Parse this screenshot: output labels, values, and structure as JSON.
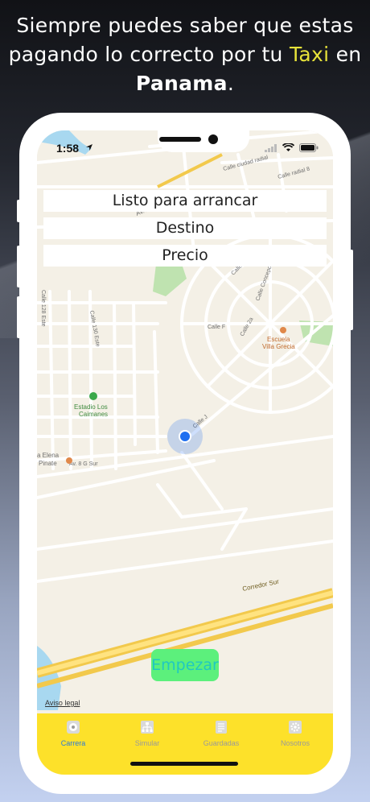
{
  "headline": {
    "part1": "Siempre puedes saber que estas pagando lo correcto por tu ",
    "taxi_word": "Taxi",
    "part2": " en ",
    "place": "Panama",
    "period": "."
  },
  "colors": {
    "taxi_accent": "#e6e23a",
    "tabbar_bg": "#fde12a",
    "tab_active": "#2a7ad8",
    "button_bg": "#5cf07c",
    "button_text": "#20c8c0",
    "location_dot": "#1e6ff0"
  },
  "status_bar": {
    "time": "1:58"
  },
  "map": {
    "labels": {
      "agustin": "Av. Agustín Arango",
      "ciudad_radial": "Calle ciudad radial",
      "radial8": "Calle radial 8",
      "calle4a": "Calle 4a",
      "concepcion": "Calle Concepción",
      "callef": "Calle F",
      "calle2a": "Calle 2a",
      "calle128": "Calle 128 Este",
      "calle130": "Calle 130 Este",
      "escuela1": "Escuela",
      "escuela2": "Villa Grecia",
      "estadio1": "Estadio Los",
      "estadio2": "Caimanes",
      "elena1": "a Elena",
      "elena2": "Pinate",
      "av8g": "Av. 8 G Sur",
      "callej": "Calle J",
      "corredor": "Corredor Sur"
    },
    "legal": "Aviso legal"
  },
  "info": {
    "status": "Listo para arrancar",
    "destino": "Destino",
    "precio": "Precio"
  },
  "actions": {
    "start": "Empezar"
  },
  "tabs": [
    {
      "label": "Carrera",
      "icon": "chat-icon",
      "active": true
    },
    {
      "label": "Simular",
      "icon": "sitemap-icon",
      "active": false
    },
    {
      "label": "Guardadas",
      "icon": "document-icon",
      "active": false
    },
    {
      "label": "Nosotros",
      "icon": "gear-icon",
      "active": false
    }
  ]
}
